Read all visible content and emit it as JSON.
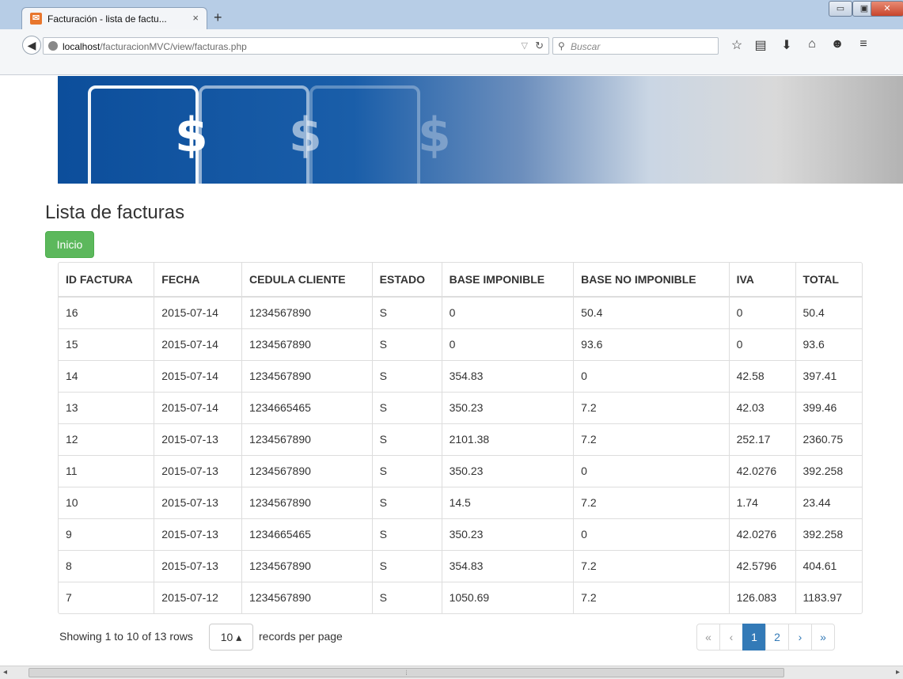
{
  "browser": {
    "tab_title": "Facturación - lista de factu...",
    "tab_close": "×",
    "new_tab": "+",
    "url_host": "localhost",
    "url_path": "/facturacionMVC/view/facturas.php",
    "search_placeholder": "Buscar"
  },
  "page": {
    "title": "Lista de facturas",
    "inicio_button": "Inicio"
  },
  "table": {
    "columns": [
      "ID FACTURA",
      "FECHA",
      "CEDULA CLIENTE",
      "ESTADO",
      "BASE IMPONIBLE",
      "BASE NO IMPONIBLE",
      "IVA",
      "TOTAL"
    ],
    "rows": [
      [
        "16",
        "2015-07-14",
        "1234567890",
        "S",
        "0",
        "50.4",
        "0",
        "50.4"
      ],
      [
        "15",
        "2015-07-14",
        "1234567890",
        "S",
        "0",
        "93.6",
        "0",
        "93.6"
      ],
      [
        "14",
        "2015-07-14",
        "1234567890",
        "S",
        "354.83",
        "0",
        "42.58",
        "397.41"
      ],
      [
        "13",
        "2015-07-14",
        "1234665465",
        "S",
        "350.23",
        "7.2",
        "42.03",
        "399.46"
      ],
      [
        "12",
        "2015-07-13",
        "1234567890",
        "S",
        "2101.38",
        "7.2",
        "252.17",
        "2360.75"
      ],
      [
        "11",
        "2015-07-13",
        "1234567890",
        "S",
        "350.23",
        "0",
        "42.0276",
        "392.258"
      ],
      [
        "10",
        "2015-07-13",
        "1234567890",
        "S",
        "14.5",
        "7.2",
        "1.74",
        "23.44"
      ],
      [
        "9",
        "2015-07-13",
        "1234665465",
        "S",
        "350.23",
        "0",
        "42.0276",
        "392.258"
      ],
      [
        "8",
        "2015-07-13",
        "1234567890",
        "S",
        "354.83",
        "7.2",
        "42.5796",
        "404.61"
      ],
      [
        "7",
        "2015-07-12",
        "1234567890",
        "S",
        "1050.69",
        "7.2",
        "126.083",
        "1183.97"
      ]
    ]
  },
  "pagination": {
    "info": "Showing 1 to 10 of 13 rows",
    "page_size": "10",
    "records_per_page": "records per page",
    "first": "«",
    "prev": "‹",
    "pages": [
      "1",
      "2"
    ],
    "next": "›",
    "last": "»"
  },
  "colors": {
    "success": "#5cb85c",
    "primary": "#337ab7"
  }
}
